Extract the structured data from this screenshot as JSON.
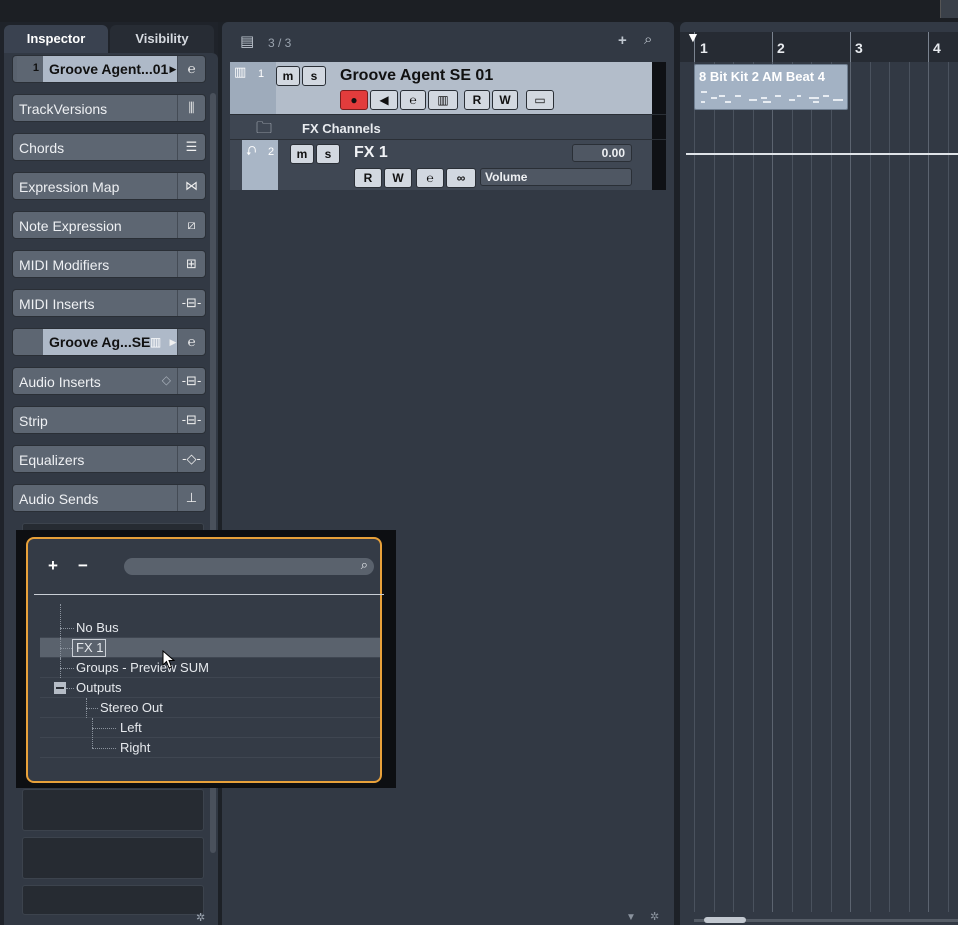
{
  "inspector": {
    "tabs": [
      "Inspector",
      "Visibility"
    ],
    "track": {
      "number": "1",
      "name": "Groove Agent...01"
    },
    "sections": [
      {
        "label": "TrackVersions",
        "icon": "track-versions-icon"
      },
      {
        "label": "Chords",
        "icon": "chords-icon"
      },
      {
        "label": "Expression Map",
        "icon": "expression-map-icon"
      },
      {
        "label": "Note Expression",
        "icon": "note-expression-icon"
      },
      {
        "label": "MIDI Modifiers",
        "icon": "midi-modifiers-icon"
      },
      {
        "label": "MIDI Inserts",
        "icon": "midi-inserts-icon"
      }
    ],
    "instrument": {
      "name": "Groove Ag...SE"
    },
    "sections2": [
      {
        "label": "Audio Inserts",
        "icon": "audio-inserts-icon"
      },
      {
        "label": "Strip",
        "icon": "strip-icon"
      },
      {
        "label": "Equalizers",
        "icon": "equalizers-icon"
      },
      {
        "label": "Audio Sends",
        "icon": "audio-sends-icon"
      }
    ]
  },
  "tracklist": {
    "count": "3 / 3",
    "tracks": [
      {
        "number": "1",
        "name": "Groove Agent SE 01",
        "buttons": [
          "m",
          "s",
          "R",
          "W"
        ]
      },
      {
        "number": "2",
        "name": "FX 1",
        "buttons": [
          "m",
          "s",
          "R",
          "W"
        ],
        "volume": "0.00",
        "automation": "Volume"
      }
    ],
    "folder": "FX Channels"
  },
  "arrange": {
    "bars": [
      "1",
      "2",
      "3",
      "4"
    ],
    "event": "8 Bit Kit 2 AM Beat 4"
  },
  "popup": {
    "add_label": "+",
    "remove_label": "−",
    "items": [
      {
        "label": "No Bus"
      },
      {
        "label": "FX 1",
        "selected": true
      },
      {
        "label": "Groups - Preview SUM"
      },
      {
        "label": "Outputs"
      },
      {
        "label": "Stereo Out"
      },
      {
        "label": "Left"
      },
      {
        "label": "Right"
      }
    ]
  },
  "colors": {
    "accent_orange": "#e8a13a",
    "record_red": "#e23c3c"
  }
}
